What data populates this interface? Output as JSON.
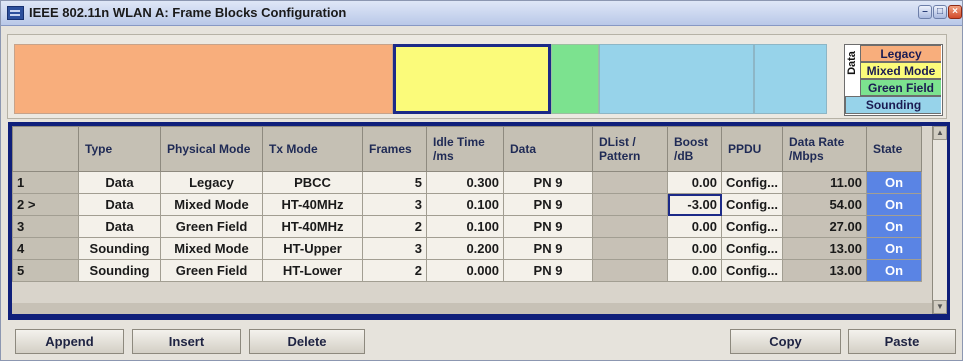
{
  "window": {
    "title": "IEEE 802.11n WLAN  A: Frame Blocks Configuration",
    "controls": [
      "minimize",
      "maximize",
      "close"
    ]
  },
  "legend": {
    "axis_label": "Data",
    "items": [
      {
        "label": "Legacy",
        "color": "#f8ae7c"
      },
      {
        "label": "Mixed Mode",
        "color": "#fbfb7a"
      },
      {
        "label": "Green Field",
        "color": "#7ce28f"
      },
      {
        "label": "Sounding",
        "color": "#97d3ea"
      }
    ]
  },
  "block_colors": {
    "legacy": "#f8ae7c",
    "mixed_mode": "#fbfb7a",
    "green_field": "#7ce28f",
    "sounding": "#97d3ea",
    "selected_border": "#1c2a88"
  },
  "table": {
    "headers": [
      "",
      "Type",
      "Physical Mode",
      "Tx Mode",
      "Frames",
      "Idle Time /ms",
      "Data",
      "DList / Pattern",
      "Boost /dB",
      "PPDU",
      "Data Rate /Mbps",
      "State"
    ],
    "rows": [
      {
        "index": "1",
        "type": "Data",
        "physical_mode": "Legacy",
        "tx_mode": "PBCC",
        "frames": "5",
        "idle_time": "0.300",
        "data": "PN 9",
        "dlist": "",
        "boost": "0.00",
        "ppdu": "Config...",
        "data_rate": "11.00",
        "state": "On"
      },
      {
        "index": "2 >",
        "type": "Data",
        "physical_mode": "Mixed Mode",
        "tx_mode": "HT-40MHz",
        "frames": "3",
        "idle_time": "0.100",
        "data": "PN 9",
        "dlist": "",
        "boost": "-3.00",
        "ppdu": "Config...",
        "data_rate": "54.00",
        "state": "On"
      },
      {
        "index": "3",
        "type": "Data",
        "physical_mode": "Green Field",
        "tx_mode": "HT-40MHz",
        "frames": "2",
        "idle_time": "0.100",
        "data": "PN 9",
        "dlist": "",
        "boost": "0.00",
        "ppdu": "Config...",
        "data_rate": "27.00",
        "state": "On"
      },
      {
        "index": "4",
        "type": "Sounding",
        "physical_mode": "Mixed Mode",
        "tx_mode": "HT-Upper",
        "frames": "3",
        "idle_time": "0.200",
        "data": "PN 9",
        "dlist": "",
        "boost": "0.00",
        "ppdu": "Config...",
        "data_rate": "13.00",
        "state": "On"
      },
      {
        "index": "5",
        "type": "Sounding",
        "physical_mode": "Green Field",
        "tx_mode": "HT-Lower",
        "frames": "2",
        "idle_time": "0.000",
        "data": "PN 9",
        "dlist": "",
        "boost": "0.00",
        "ppdu": "Config...",
        "data_rate": "13.00",
        "state": "On"
      }
    ]
  },
  "buttons": {
    "append": "Append",
    "insert": "Insert",
    "delete": "Delete",
    "copy": "Copy",
    "paste": "Paste"
  },
  "icons": {
    "scroll_up": "▲",
    "scroll_down": "▼",
    "minimize": "–",
    "maximize": "□",
    "close": "×"
  }
}
